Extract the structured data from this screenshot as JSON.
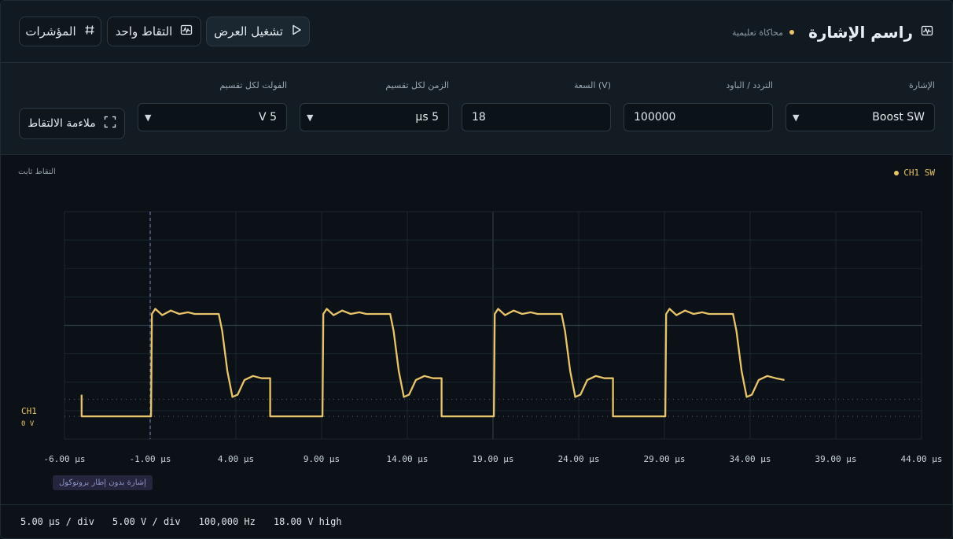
{
  "header": {
    "title": "راسم الإشارة",
    "subtitle": "محاكاة تعليمية",
    "buttons": {
      "run": "تشغيل العرض",
      "single": "التقاط واحد",
      "cursors": "المؤشرات"
    }
  },
  "controls": {
    "signal_label": "الإشارة",
    "signal_value": "Boost SW",
    "frequency_label": "التردد / الباود",
    "frequency_value": "100000",
    "amplitude_label": "السعة (V)",
    "amplitude_value": "18",
    "timebase_label": "الزمن لكل تقسيم",
    "timebase_value": "5 µs",
    "voltdiv_label": "الفولت لكل تقسيم",
    "voltdiv_value": "5 V",
    "fit_button": "ملاءمة الالتقاط"
  },
  "scope": {
    "status": "التقاط ثابت",
    "channel_legend": "CH1 SW",
    "channel_name": "CH1",
    "channel_offset": "0 V",
    "protocol_tag": "إشارة بدون إطار بروتوكول"
  },
  "footer": {
    "timebase": "5.00 µs / div",
    "voltdiv": "5.00 V / div",
    "frequency": "100,000 Hz",
    "amplitude": "18.00 V high"
  },
  "colors": {
    "trace": "#e9c46a",
    "accent": "#e9c46a",
    "background": "#0b1117"
  },
  "chart_data": {
    "type": "line",
    "x_tick_labels": [
      "-6.00 µs",
      "-1.00 µs",
      "4.00 µs",
      "9.00 µs",
      "14.00 µs",
      "19.00 µs",
      "24.00 µs",
      "29.00 µs",
      "34.00 µs",
      "39.00 µs",
      "44.00 µs"
    ],
    "xlim": [
      -6,
      44
    ],
    "ylim": [
      -4,
      36
    ],
    "trigger_x": -1,
    "high_level": 18,
    "series": [
      {
        "name": "CH1 SW",
        "x": [
          -5,
          -5,
          -0.95,
          -0.9,
          -0.7,
          -0.3,
          0.2,
          0.7,
          1.2,
          1.6,
          2.0,
          2.6,
          3.0,
          3.2,
          3.5,
          3.8,
          4.1,
          4.5,
          5.0,
          5.5,
          6.0,
          6.0,
          9.05,
          9.1,
          9.3,
          9.7,
          10.2,
          10.7,
          11.2,
          11.6,
          12.0,
          12.6,
          13.0,
          13.2,
          13.5,
          13.8,
          14.1,
          14.5,
          15.0,
          15.5,
          16.0,
          16.0,
          19.05,
          19.1,
          19.3,
          19.7,
          20.2,
          20.7,
          21.2,
          21.6,
          22.0,
          22.6,
          23.0,
          23.2,
          23.5,
          23.8,
          24.1,
          24.5,
          25.0,
          25.5,
          26.0,
          26.0,
          29.05,
          29.1,
          29.3,
          29.7,
          30.2,
          30.7,
          31.2,
          31.6,
          32.0,
          32.6,
          33.0,
          33.2,
          33.5,
          33.8,
          34.1,
          34.5,
          35.0,
          35.5,
          36.0
        ],
        "y": [
          3.8,
          0,
          0,
          18,
          18.9,
          17.8,
          18.6,
          18,
          18.3,
          18,
          18,
          18,
          18,
          15,
          8,
          3.4,
          3.8,
          6.4,
          7.1,
          6.7,
          6.7,
          0,
          0,
          18,
          18.9,
          17.8,
          18.6,
          18,
          18.3,
          18,
          18,
          18,
          18,
          15,
          8,
          3.4,
          3.8,
          6.4,
          7.1,
          6.7,
          6.7,
          0,
          0,
          18,
          18.9,
          17.8,
          18.6,
          18,
          18.3,
          18,
          18,
          18,
          18,
          15,
          8,
          3.4,
          3.8,
          6.4,
          7.1,
          6.7,
          6.7,
          0,
          0,
          18,
          18.9,
          17.8,
          18.6,
          18,
          18.3,
          18,
          18,
          18,
          18,
          15,
          8,
          3.4,
          3.8,
          6.4,
          7.1,
          6.7,
          6.4
        ]
      }
    ],
    "grid": true
  }
}
